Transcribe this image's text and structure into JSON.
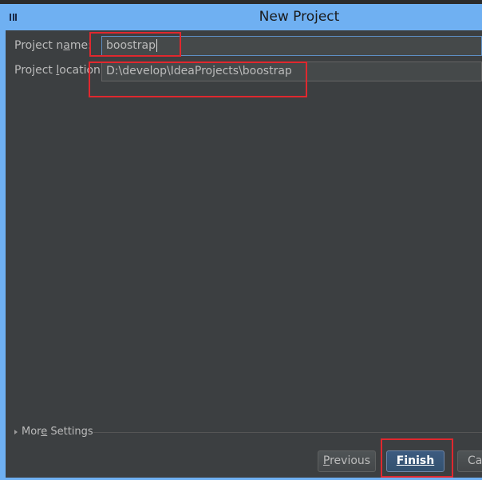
{
  "window": {
    "title": "New Project",
    "app_icon": "intellij-idea-icon"
  },
  "form": {
    "project_name": {
      "label_pre": "Project n",
      "label_mnemonic": "a",
      "label_post": "me:",
      "value": "boostrap"
    },
    "project_location": {
      "label_pre": "Project ",
      "label_mnemonic": "l",
      "label_post": "ocation:",
      "value": "D:\\develop\\IdeaProjects\\boostrap"
    }
  },
  "more_settings": {
    "label_pre": "Mor",
    "label_mnemonic": "e",
    "label_post": " Settings",
    "icon": "expand-triangle-icon"
  },
  "buttons": {
    "previous": {
      "mnemonic": "P",
      "rest": "revious"
    },
    "finish": {
      "mnemonic": "F",
      "rest": "inish"
    },
    "cancel": {
      "visible_text": "Ca"
    }
  },
  "colors": {
    "titlebar": "#6fb0f2",
    "dialog_bg": "#3c3f41",
    "highlight_box": "#e0282e",
    "default_button": "#3d5b80"
  }
}
